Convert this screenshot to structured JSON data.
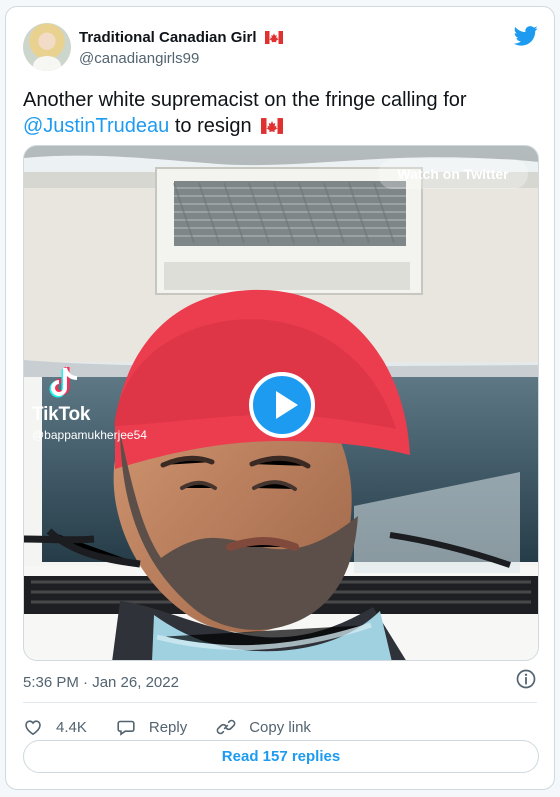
{
  "tweet": {
    "author_name": "Traditional Canadian Girl",
    "author_flag": "🇨🇦",
    "handle": "@canadiangirls99",
    "text_before": "Another white supremacist on the fringe calling for",
    "mention": "@JustinTrudeau",
    "text_after": " to resign",
    "text_flag": "🇨🇦",
    "timestamp": "5:36 PM · Jan 26, 2022",
    "likes": "4.4K",
    "reply_label": "Reply",
    "copy_link_label": "Copy link",
    "read_replies_label": "Read 157 replies"
  },
  "media": {
    "watch_label": "Watch on Twitter",
    "tiktok_label": "TikTok",
    "tiktok_user": "@bappamukherjee54"
  },
  "colors": {
    "accent": "#1d9bf0",
    "text": "#0f1419",
    "muted": "#536471",
    "border": "#cfd9de"
  },
  "icons": [
    "twitter-bird-icon",
    "canada-flag-icon",
    "play-icon",
    "tiktok-icon",
    "info-icon",
    "heart-icon",
    "reply-icon",
    "copy-link-icon"
  ]
}
